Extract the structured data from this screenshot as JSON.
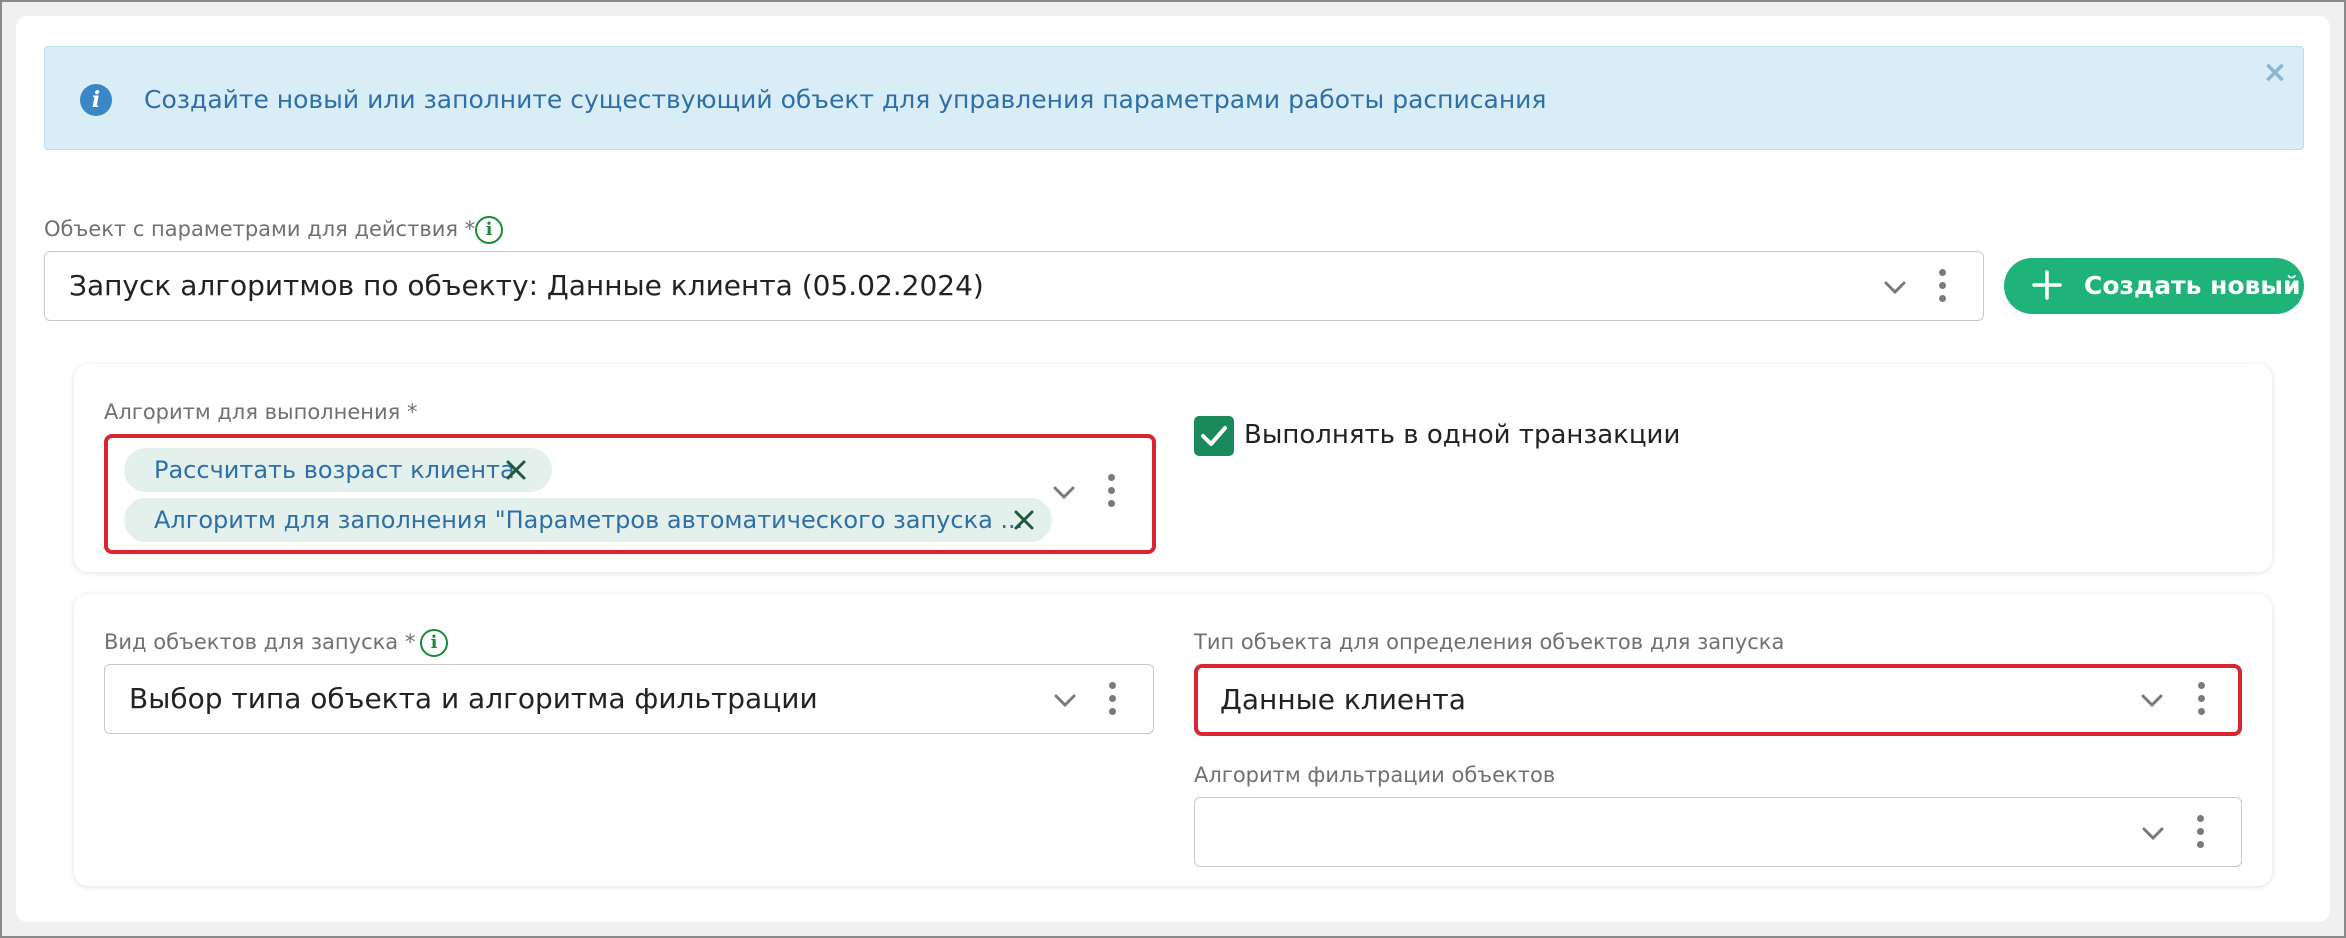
{
  "alert": {
    "icon": "info-icon",
    "text": "Создайте новый или заполните существующий объект для управления параметрами работы расписания",
    "close_icon": "close-icon"
  },
  "params_object": {
    "label": "Объект с параметрами для действия *",
    "value": "Запуск алгоритмов по объекту: Данные клиента (05.02.2024)",
    "create_button": "Создать новый"
  },
  "algorithm": {
    "label": "Алгоритм для выполнения *",
    "chips": [
      "Рассчитать возраст клиента",
      "Алгоритм для заполнения \"Параметров автоматического запуска ..."
    ],
    "single_transaction_label": "Выполнять в одной транзакции",
    "single_transaction_checked": true
  },
  "launch": {
    "objects_kind_label": "Вид объектов для запуска *",
    "objects_kind_value": "Выбор типа объекта и алгоритма фильтрации",
    "object_type_label": "Тип объекта для определения объектов для запуска",
    "object_type_value": "Данные клиента",
    "filter_algorithm_label": "Алгоритм фильтрации объектов",
    "filter_algorithm_value": ""
  },
  "colors": {
    "accent_green": "#1fb37a",
    "highlight_red": "#d9252f",
    "info_blue": "#3a87c7",
    "alert_bg": "#d9edf7"
  }
}
